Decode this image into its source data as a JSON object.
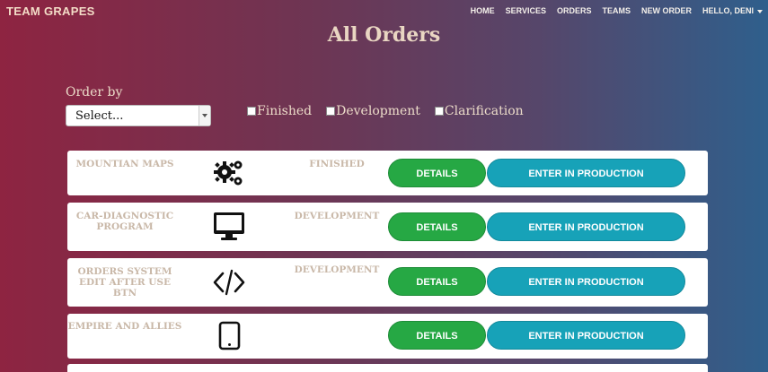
{
  "navbar": {
    "brand": "TEAM GRAPES",
    "links": [
      "HOME",
      "SERVICES",
      "ORDERS",
      "TEAMS",
      "NEW ORDER",
      "HELLO, DENI"
    ]
  },
  "page": {
    "title": "All Orders"
  },
  "controls": {
    "order_by_label": "Order by",
    "select_value": "Select...",
    "filters": [
      "Finished",
      "Development",
      "Clarification"
    ]
  },
  "orders": [
    {
      "name": "MOUNTIAN MAPS",
      "icon": "gears-icon",
      "status": "FINISHED",
      "details_label": "DETAILS",
      "production_label": "ENTER IN PRODUCTION"
    },
    {
      "name": "CAR-DIAGNOSTIC PROGRAM",
      "icon": "monitor-icon",
      "status": "DEVELOPMENT",
      "details_label": "DETAILS",
      "production_label": "ENTER IN PRODUCTION"
    },
    {
      "name": "ORDERS SYSTEM EDIT AFTER USE BTN",
      "icon": "code-icon",
      "status": "DEVELOPMENT",
      "details_label": "DETAILS",
      "production_label": "ENTER IN PRODUCTION"
    },
    {
      "name": "EMPIRE AND ALLIES",
      "icon": "tablet-icon",
      "status": "",
      "details_label": "DETAILS",
      "production_label": "ENTER IN PRODUCTION"
    }
  ],
  "colors": {
    "details_button": "#26a844",
    "production_button": "#17a2b8",
    "muted_text": "#c9b8a8"
  }
}
